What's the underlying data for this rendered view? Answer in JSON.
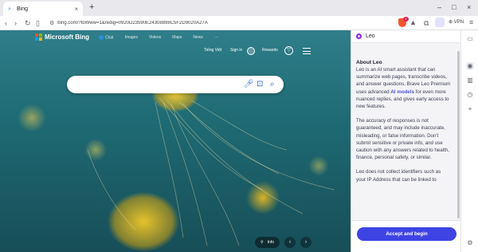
{
  "browser": {
    "tab_title": "Bing",
    "url": "bing.com/?toWww=1&redig=0920D23590E24308898C5F2D9020A27A",
    "vpn_label": "VPN",
    "shield_count": "1"
  },
  "bing": {
    "logo_text": "Microsoft Bing",
    "nav": [
      "Chat",
      "Images",
      "Videos",
      "Maps",
      "News",
      "···"
    ],
    "language": "Tiếng Việt",
    "sign_in": "Sign in",
    "rewards": "Rewards",
    "info_label": "Info"
  },
  "leo": {
    "header_title": "Leo",
    "about_title": "About Leo",
    "p1_before": "Leo is an AI smart assistant that can summarize web pages, transcribe videos, and answer questions. Brave Leo Premium uses advanced ",
    "p1_link": "AI models",
    "p1_after": " for even more nuanced replies, and gives early access to new features.",
    "p2": "The accuracy of responses is not guaranteed, and may include inaccurate, misleading, or false information. Don't submit sensitive or private info, and use caution with any answers related to health, finance, personal safety, or similar.",
    "p3": "Leo does not collect identifiers such as your IP Address that can be linked to",
    "accept_button": "Accept and begin"
  },
  "colors": {
    "accent": "#3e44e4",
    "link": "#4c54d2",
    "brave_orange": "#fb542b"
  }
}
